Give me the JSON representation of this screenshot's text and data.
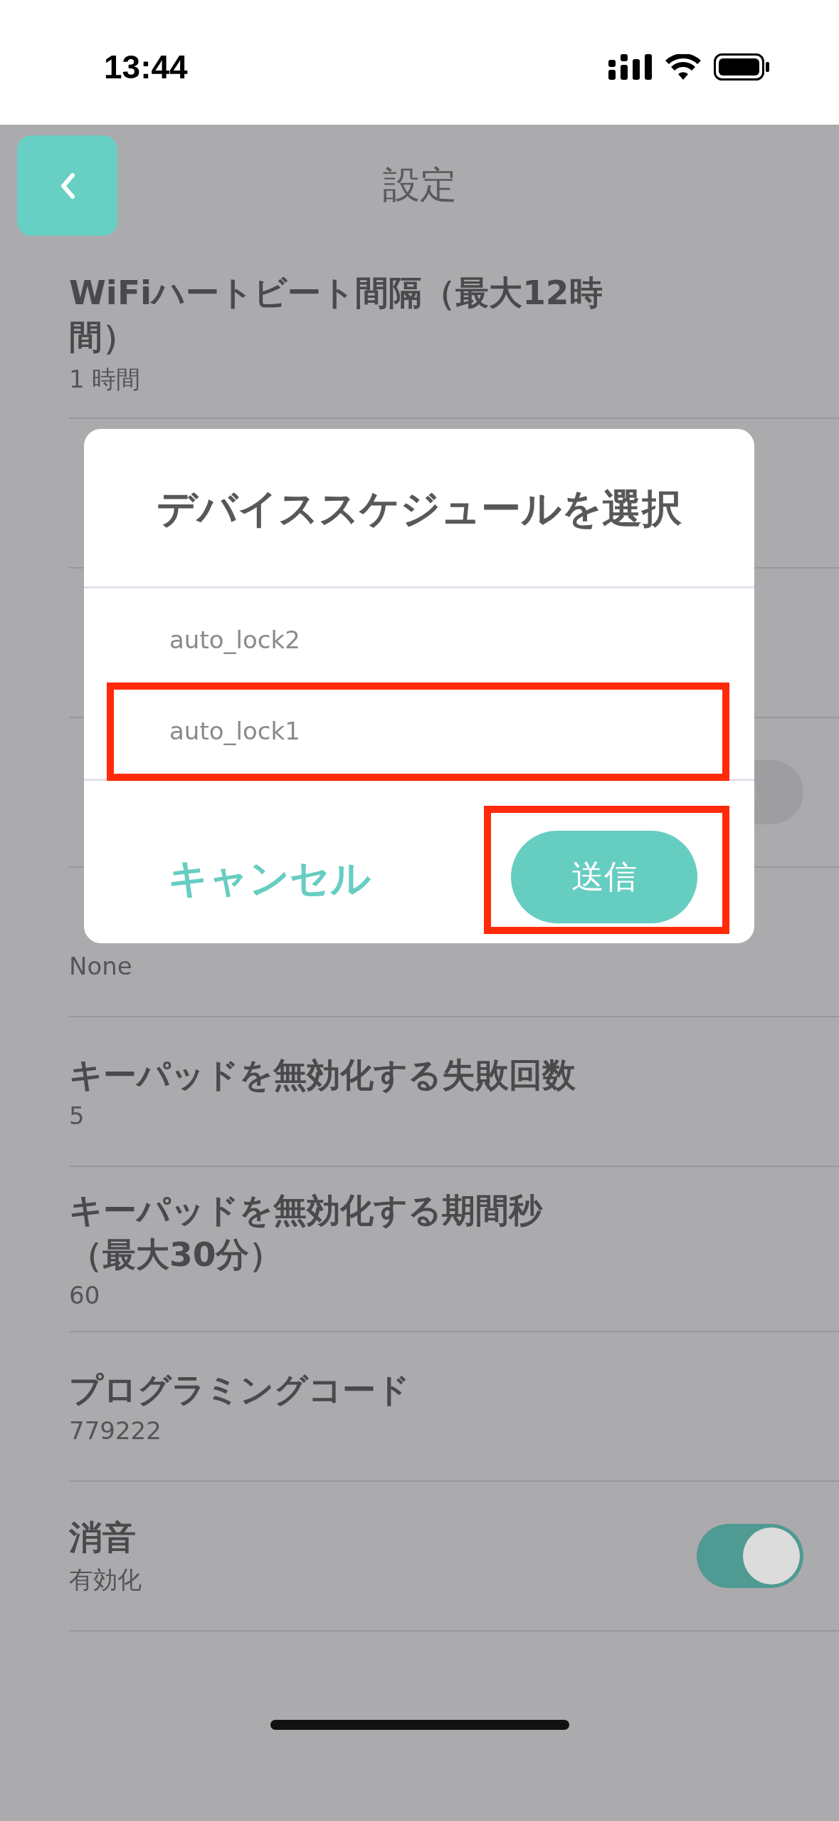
{
  "status_bar": {
    "time": "13:44"
  },
  "header": {
    "title": "設定"
  },
  "settings": [
    {
      "kind": "chevron",
      "title_lines": [
        "WiFiハートビート間隔（最大12時",
        "間）"
      ],
      "value": "1 時間"
    },
    {
      "kind": "arc"
    },
    {
      "kind": "chevron"
    },
    {
      "kind": "toggle",
      "on": false
    },
    {
      "kind": "chevron",
      "value": "None"
    },
    {
      "kind": "keypad",
      "title_lines": [
        "キーパッドを無効化する失敗回数"
      ],
      "value": "5"
    },
    {
      "kind": "keypad",
      "title_lines": [
        "キーパッドを無効化する期間秒",
        "（最大30分）"
      ],
      "value": "60"
    },
    {
      "kind": "keypad",
      "title_lines": [
        "プログラミングコード"
      ],
      "value": "779222"
    },
    {
      "kind": "toggle",
      "on": true,
      "title_lines": [
        "消音"
      ],
      "value": "有効化"
    }
  ],
  "dialog": {
    "title": "デバイススケジュールを選択",
    "options": [
      {
        "label": "auto_lock2",
        "highlighted": false
      },
      {
        "label": "auto_lock1",
        "highlighted": true
      }
    ],
    "cancel": "キャンセル",
    "submit": {
      "label": "送信",
      "highlighted": true
    }
  }
}
